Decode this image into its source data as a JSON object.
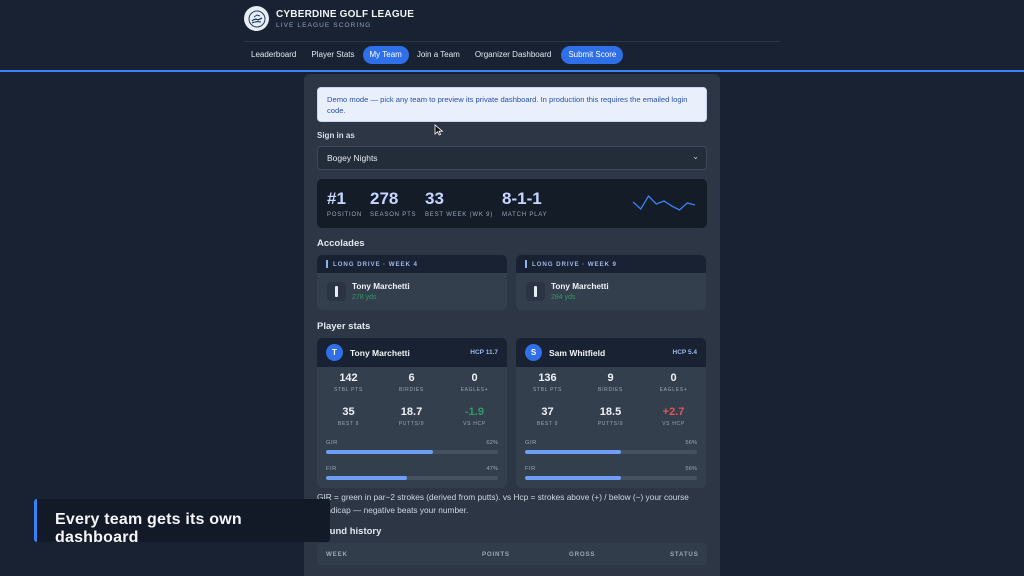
{
  "header": {
    "title": "CYBERDINE GOLF LEAGUE",
    "subtitle": "LIVE LEAGUE SCORING",
    "logo_icon": "golf-hand-logo-icon",
    "accent": "#3b82f6"
  },
  "nav": {
    "items": [
      {
        "label": "Leaderboard"
      },
      {
        "label": "Player Stats"
      },
      {
        "label": "My Team",
        "active": true
      },
      {
        "label": "Join a Team"
      },
      {
        "label": "Organizer Dashboard"
      },
      {
        "label": "Submit Score"
      }
    ]
  },
  "demo_notice": "Demo mode — pick any team to preview its private dashboard. In production this requires the emailed login code.",
  "signin": {
    "label": "Sign in as",
    "selected": "Bogey Nights"
  },
  "summary": {
    "position": {
      "value": "#1",
      "label": "POSITION"
    },
    "season_pts": {
      "value": "278",
      "label": "SEASON PTS"
    },
    "best_week": {
      "value": "33",
      "label": "BEST WEEK (WK 9)"
    },
    "match_play": {
      "value": "8-1-1",
      "label": "MATCH PLAY"
    },
    "sparkline": [
      0.55,
      0.2,
      0.85,
      0.45,
      0.6,
      0.35,
      0.15,
      0.5,
      0.4
    ]
  },
  "accolades": {
    "title": "Accolades",
    "items": [
      {
        "head": "LONG DRIVE · WEEK 4",
        "name": "Tony Marchetti",
        "detail": "278 yds"
      },
      {
        "head": "LONG DRIVE · WEEK 9",
        "name": "Tony Marchetti",
        "detail": "284 yds"
      }
    ]
  },
  "player_stats": {
    "title": "Player stats",
    "players": [
      {
        "initial": "T",
        "name": "Tony Marchetti",
        "hcp": "HCP 11.7",
        "stbl": "142",
        "birdies": "6",
        "eagles": "0",
        "best9": "35",
        "putts9": "18.7",
        "vs_hcp": "-1.9",
        "gir_pct": "62%",
        "fir_pct": "47%",
        "gir_frac": 0.62,
        "fir_frac": 0.47
      },
      {
        "initial": "S",
        "name": "Sam Whitfield",
        "hcp": "HCP 5.4",
        "stbl": "136",
        "birdies": "9",
        "eagles": "0",
        "best9": "37",
        "putts9": "18.5",
        "vs_hcp": "+2.7",
        "gir_pct": "56%",
        "fir_pct": "56%",
        "gir_frac": 0.56,
        "fir_frac": 0.56
      }
    ],
    "labels": {
      "stbl": "STBL PTS",
      "birdies": "BIRDIES",
      "eagles": "EAGLES+",
      "best9": "BEST 9",
      "putts9": "PUTTS/9",
      "vs_hcp": "VS HCP",
      "gir": "GIR",
      "fir": "FIR"
    }
  },
  "note": "GIR = green in par−2 strokes (derived from putts). vs Hcp = strokes above (+) / below (−) your course handicap — negative beats your number.",
  "round_history": {
    "title": "Round history",
    "columns": [
      "WEEK",
      "POINTS",
      "GROSS",
      "STATUS"
    ]
  },
  "caption": "Every team gets its own dashboard"
}
